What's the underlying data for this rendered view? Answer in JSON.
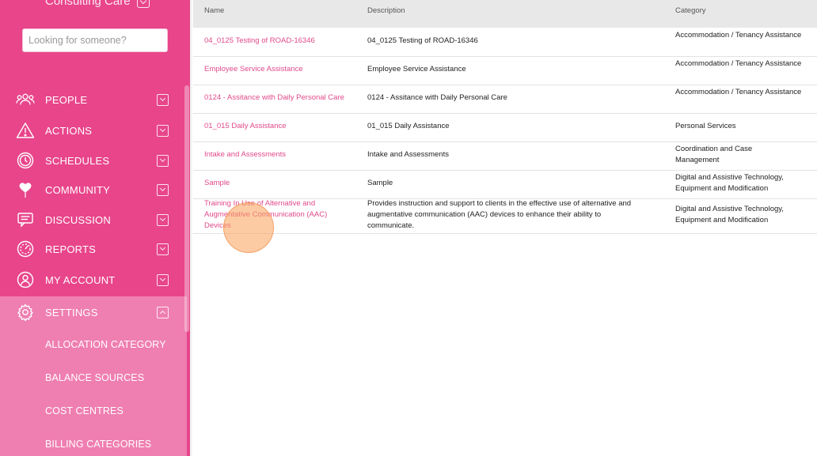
{
  "brand": {
    "name": "Consulting Care"
  },
  "search": {
    "placeholder": "Looking for someone?"
  },
  "sidebar": {
    "items": [
      {
        "label": "PEOPLE",
        "icon": "people-icon"
      },
      {
        "label": "ACTIONS",
        "icon": "warning-icon"
      },
      {
        "label": "SCHEDULES",
        "icon": "clock-icon"
      },
      {
        "label": "COMMUNITY",
        "icon": "balloon-icon"
      },
      {
        "label": "DISCUSSION",
        "icon": "chat-icon"
      },
      {
        "label": "REPORTS",
        "icon": "gauge-icon"
      },
      {
        "label": "MY ACCOUNT",
        "icon": "user-icon"
      },
      {
        "label": "SETTINGS",
        "icon": "gear-icon"
      }
    ],
    "settings_sub_items": [
      "ALLOCATION CATEGORY",
      "BALANCE SOURCES",
      "COST CENTRES",
      "BILLING CATEGORIES"
    ]
  },
  "table": {
    "headers": {
      "name": "Name",
      "description": "Description",
      "category": "Category"
    },
    "rows": [
      {
        "name": "04_0125 Testing of ROAD-16346",
        "description": "04_0125 Testing of ROAD-16346",
        "category": "Accommodation / Tenancy Assistance"
      },
      {
        "name": "Employee Service Assistance",
        "description": "Employee Service Assistance",
        "category": "Accommodation / Tenancy Assistance"
      },
      {
        "name": "0124 - Assitance with Daily Personal Care",
        "description": "0124 - Assitance with Daily Personal Care",
        "category": "Accommodation / Tenancy Assistance"
      },
      {
        "name": "01_015 Daily Assistance",
        "description": "01_015 Daily Assistance",
        "category": "Personal Services"
      },
      {
        "name": "Intake and Assessments",
        "description": "Intake and Assessments",
        "category": "Coordination and Case Management"
      },
      {
        "name": "Sample",
        "description": "Sample",
        "category": "Digital and Assistive Technology, Equipment and Modification"
      },
      {
        "name": "Training In Use of Alternative and Augmentative Communication (AAC) Devices",
        "description": "Provides instruction and support to clients in the effective use of alternative and augmentative communication (AAC) devices to enhance their ability to communicate.",
        "category": "Digital and Assistive Technology, Equipment and Modification"
      }
    ]
  },
  "colors": {
    "sidebar": "#e8458b",
    "settings_active": "#ef7eb1",
    "link": "#e0498a",
    "header_bg": "#e8e8e8"
  }
}
